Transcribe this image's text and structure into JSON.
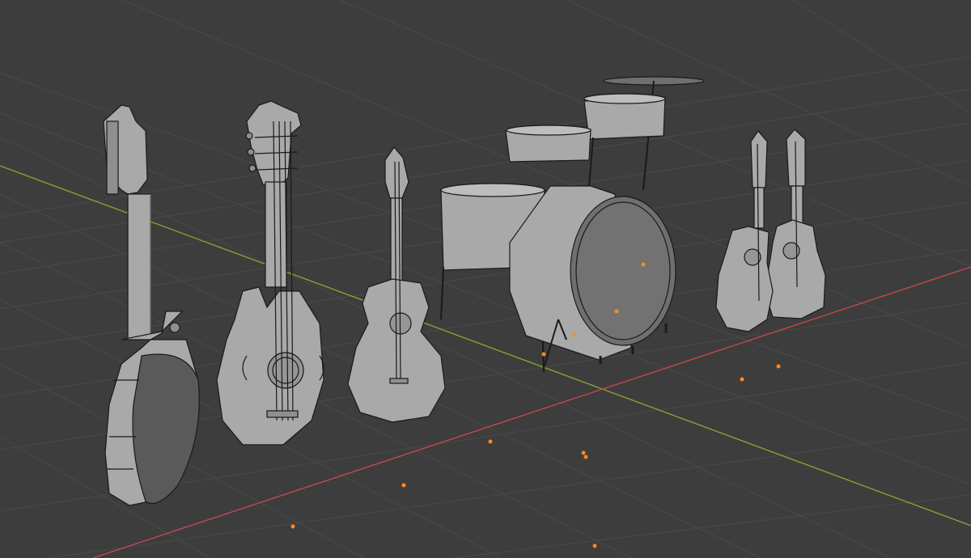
{
  "viewport": {
    "background_color": "#3d3d3d",
    "grid_color": "#4a4a4a",
    "x_axis_color": "#c0484f",
    "y_axis_color": "#86a232",
    "mesh_fill": "#a9a9a9",
    "mesh_shadow": "#6f6f6f",
    "mesh_dark": "#5a5a5a",
    "edge_color": "#1a1a1a",
    "origin_color": "#ff8c1a"
  },
  "objects": [
    {
      "name": "mandolin-back",
      "icon": "mandolin-icon"
    },
    {
      "name": "mandolin-f-style",
      "icon": "mandolin-icon"
    },
    {
      "name": "acoustic-guitar-small",
      "icon": "guitar-icon"
    },
    {
      "name": "drum-kit",
      "icon": "drum-icon"
    },
    {
      "name": "acoustic-guitar-pair",
      "icon": "guitar-icon"
    }
  ]
}
